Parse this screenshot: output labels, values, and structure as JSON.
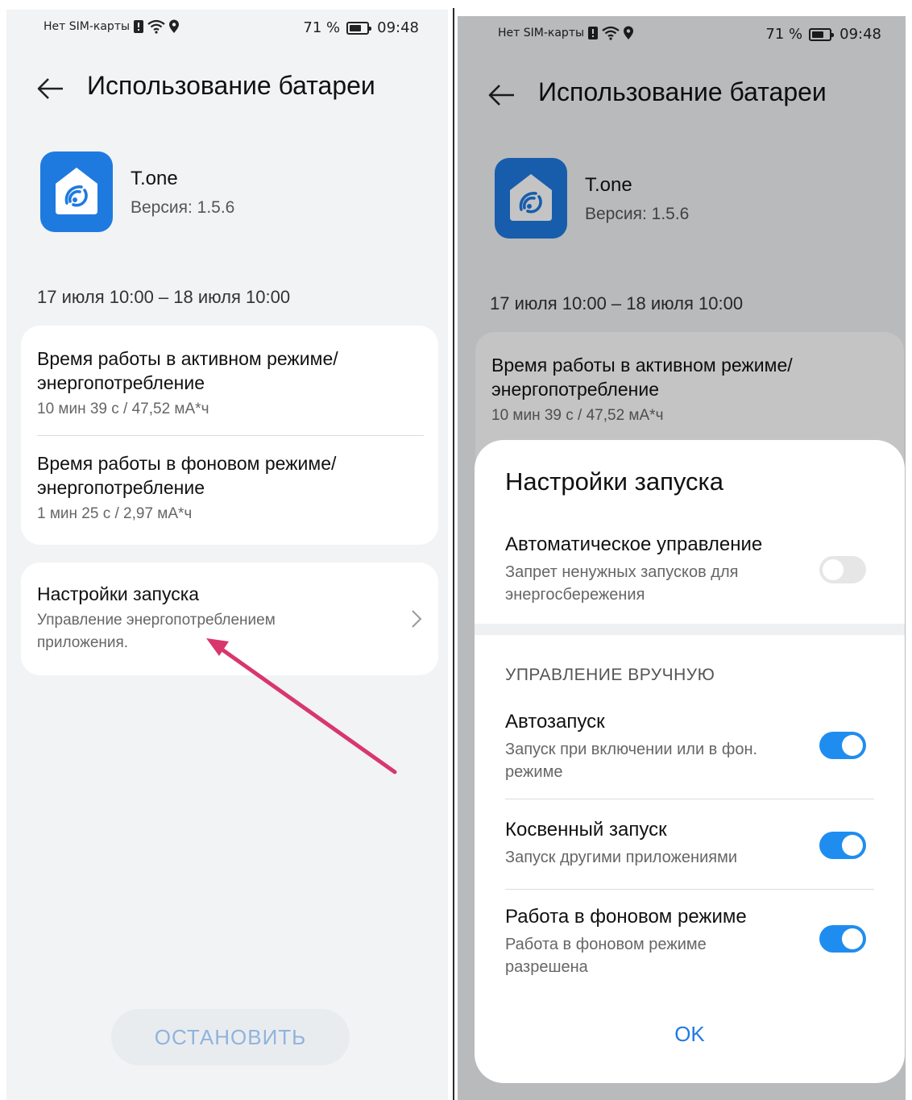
{
  "colors": {
    "accent": "#1f7ae0",
    "toggle_on": "#1f8df0",
    "arrow": "#d9366e",
    "background": "#f1f3f5"
  },
  "left_screen": {
    "status": {
      "sim": "Нет SIM-карты",
      "battery": "71 %",
      "time": "09:48",
      "battery_level": 0.71
    },
    "header": {
      "back_icon": "arrow-left-icon",
      "title": "Использование батареи"
    },
    "app": {
      "name": "T.one",
      "version": "Версия: 1.5.6",
      "icon": "home-signal-icon"
    },
    "date_range": "17 июля 10:00 – 18 июля 10:00",
    "usage": [
      {
        "title_line1": "Время работы в активном режиме/",
        "title_line2": "энергопотребление",
        "value": "10 мин 39 с / 47,52 мА*ч"
      },
      {
        "title_line1": "Время работы в фоновом режиме/",
        "title_line2": "энергопотребление",
        "value": "1 мин 25 с / 2,97 мА*ч"
      }
    ],
    "launch_settings": {
      "title": "Настройки запуска",
      "subtitle_line1": "Управление энергопотреблением",
      "subtitle_line2": "приложения.",
      "icon": "chevron-right-icon"
    },
    "stop_button": "ОСТАНОВИТЬ"
  },
  "right_screen": {
    "status": {
      "sim": "Нет SIM-карты",
      "battery": "71 %",
      "time": "09:48",
      "battery_level": 0.71
    },
    "header": {
      "back_icon": "arrow-left-icon",
      "title": "Использование батареи"
    },
    "app": {
      "name": "T.one",
      "version": "Версия: 1.5.6"
    },
    "date_range": "17 июля 10:00 – 18 июля 10:00",
    "usage": [
      {
        "title_line1": "Время работы в активном режиме/",
        "title_line2": "энергопотребление",
        "value": "10 мин 39 с / 47,52 мА*ч"
      }
    ],
    "dialog": {
      "title": "Настройки запуска",
      "auto": {
        "title": "Автоматическое управление",
        "subtitle_line1": "Запрет ненужных запусков для",
        "subtitle_line2": "энергосбережения",
        "enabled": false
      },
      "manual_label": "УПРАВЛЕНИЕ ВРУЧНУЮ",
      "items": [
        {
          "title": "Автозапуск",
          "subtitle_line1": "Запуск при включении или в фон.",
          "subtitle_line2": "режиме",
          "enabled": true
        },
        {
          "title": "Косвенный запуск",
          "subtitle_line1": "Запуск другими приложениями",
          "subtitle_line2": "",
          "enabled": true
        },
        {
          "title": "Работа в фоновом режиме",
          "subtitle_line1": "Работа в фоновом режиме",
          "subtitle_line2": "разрешена",
          "enabled": true
        }
      ],
      "ok_label": "OK"
    }
  }
}
